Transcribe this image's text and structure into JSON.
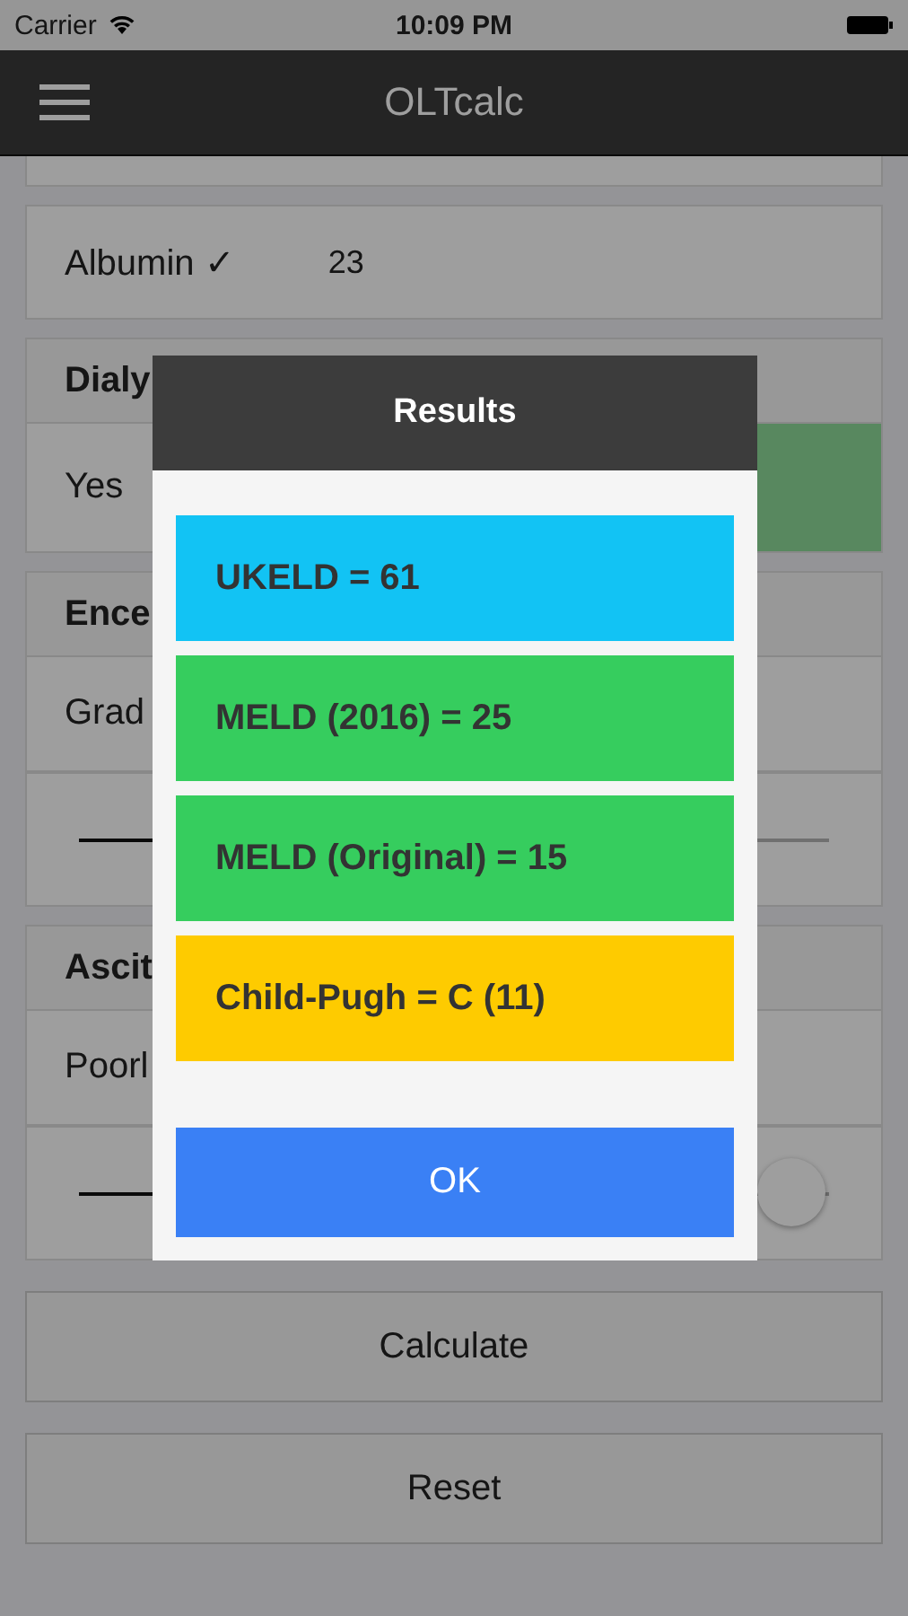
{
  "status_bar": {
    "carrier": "Carrier",
    "time": "10:09 PM"
  },
  "nav": {
    "title": "OLTcalc"
  },
  "form": [
    {
      "kind": "blank"
    },
    {
      "kind": "value",
      "label": "Albumin ✓",
      "value": "23"
    },
    {
      "kind": "header",
      "label": "Dialy"
    },
    {
      "kind": "toggle",
      "label": "Yes",
      "on": true
    },
    {
      "kind": "header",
      "label": "Ence"
    },
    {
      "kind": "text",
      "label": "Grad"
    },
    {
      "kind": "track"
    },
    {
      "kind": "header",
      "label": "Ascit"
    },
    {
      "kind": "text",
      "label": "Poorl"
    },
    {
      "kind": "slider",
      "level": 1
    }
  ],
  "buttons": [
    "Calculate",
    "Reset"
  ],
  "dialog": {
    "title": "Results",
    "results": [
      {
        "text": "UKELD = 61",
        "color": "#12c3f4"
      },
      {
        "text": "MELD (2016) = 25",
        "color": "#36cd5e"
      },
      {
        "text": "MELD (Original) = 15",
        "color": "#36cd5e"
      },
      {
        "text": "Child-Pugh = C (11)",
        "color": "#fecb00"
      }
    ],
    "ok": "OK"
  }
}
